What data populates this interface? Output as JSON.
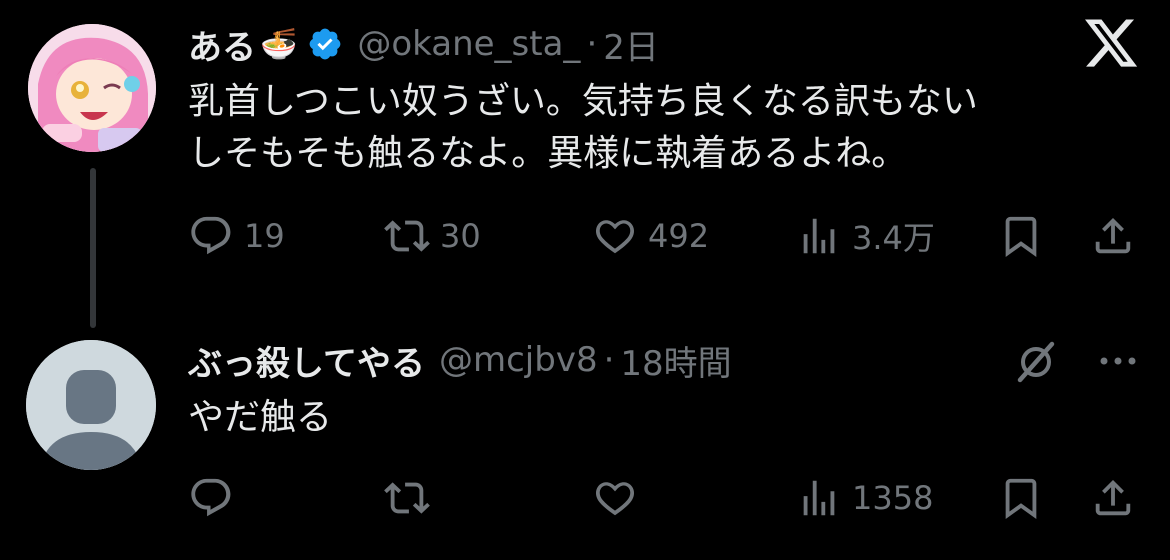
{
  "tweet1": {
    "name": "ある",
    "emoji": "🍜",
    "handle": "@okane_sta_",
    "sep": "·",
    "time": "2日",
    "text_line1": "乳首しつこい奴うざい。気持ち良くなる訳もない",
    "text_line2": "しそもそも触るなよ。異様に執着あるよね。",
    "replies": "19",
    "retweets": "30",
    "likes": "492",
    "views": "3.4万"
  },
  "tweet2": {
    "name": "ぶっ殺してやる",
    "handle": "@mcjbv8",
    "sep": "·",
    "time": "18時間",
    "text": "やだ触る",
    "replies": "",
    "retweets": "",
    "likes": "",
    "views": "1358"
  },
  "colors": {
    "background": "#000000",
    "text": "#e7e9ea",
    "muted": "#71767b",
    "verified": "#1d9bf0"
  },
  "icons": [
    "x-logo-icon",
    "verified-badge-icon",
    "reply-icon",
    "retweet-icon",
    "like-icon",
    "views-icon",
    "bookmark-icon",
    "share-icon",
    "mute-icon",
    "more-icon"
  ]
}
